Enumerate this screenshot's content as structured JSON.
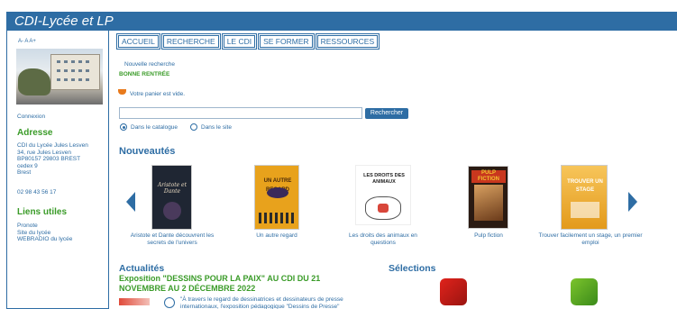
{
  "header": {
    "title": "CDI-Lycée et LP"
  },
  "sidebar": {
    "font_controls": "A- A A+",
    "login": "Connexion",
    "address_heading": "Adresse",
    "address_lines": [
      "CDI du Lycée Jules Lesven",
      "34, rue Jules Lesven",
      "BP80157 29803 BREST",
      "cedex 9",
      "Brest"
    ],
    "phone": "02 98 43 56 17",
    "links_heading": "Liens utiles",
    "links": [
      "Pronote",
      "Site du lycée",
      "WEBRADIO du lycée"
    ]
  },
  "nav": {
    "items": [
      "ACCUEIL",
      "RECHERCHE",
      "LE CDI",
      "SE FORMER",
      "RESSOURCES"
    ]
  },
  "main": {
    "new_search": "Nouvelle recherche",
    "welcome": "BONNE RENTRÉE",
    "cart_text": "Votre panier est vide.",
    "search": {
      "placeholder": "",
      "button": "Rechercher",
      "radio_catalog": "Dans le catalogue",
      "radio_site": "Dans le site",
      "selected": "Dans le catalogue"
    },
    "nouveautes_title": "Nouveautés",
    "books": [
      {
        "caption": "Aristote et Dante découvrent les secrets de l'univers",
        "cover_title": "Aristote et Dante",
        "color": "#2a2a3a"
      },
      {
        "caption": "Un autre regard",
        "cover_title": "UN AUTRE REGARD",
        "color": "#e8a21c"
      },
      {
        "caption": "Les droits des animaux en questions",
        "cover_title": "LES DROITS DES ANIMAUX",
        "color": "#ffffff"
      },
      {
        "caption": "Pulp fiction",
        "cover_title": "PULP FICTION",
        "color": "#c8371e"
      },
      {
        "caption": "Trouver facilement un stage, un premier emploi",
        "cover_title": "TROUVER UN STAGE",
        "color": "#f2b43a"
      }
    ],
    "actualites_title": "Actualités",
    "news_title": "Exposition \"DESSINS POUR LA PAIX\" AU CDI DU 21 NOVEMBRE AU 2 DÉCEMBRE 2022",
    "news_text": "\"À travers le regard de dessinatrices et dessinateurs de presse internationaux, l'exposition pédagogique \"Dessins de Presse\"",
    "selections_title": "Sélections"
  },
  "colors": {
    "brand_blue": "#2e6da4",
    "accent_green": "#3a9b28"
  }
}
